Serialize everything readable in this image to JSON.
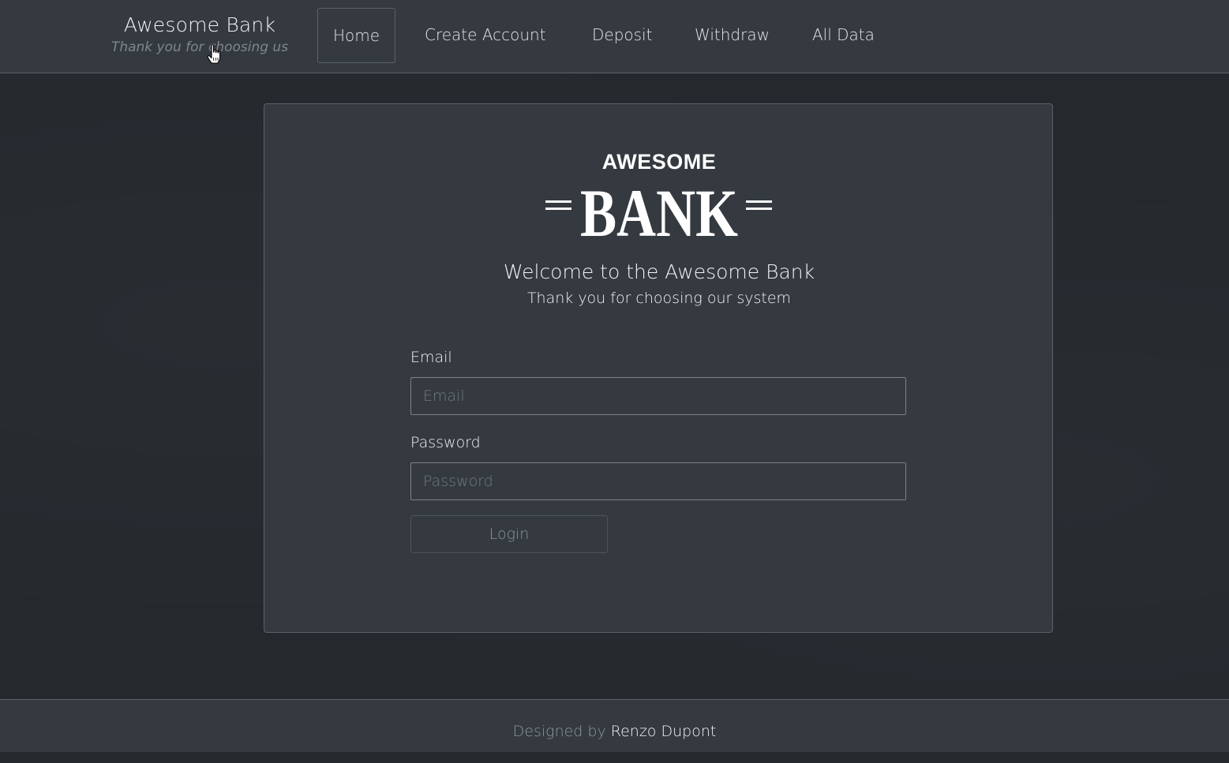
{
  "brand": {
    "title": "Awesome Bank",
    "subtitle": "Thank you for choosing us"
  },
  "nav": {
    "items": [
      {
        "label": "Home",
        "active": true
      },
      {
        "label": "Create Account",
        "active": false
      },
      {
        "label": "Deposit",
        "active": false
      },
      {
        "label": "Withdraw",
        "active": false
      },
      {
        "label": "All Data",
        "active": false
      }
    ]
  },
  "card": {
    "logo": {
      "top_text": "AWESOME",
      "main_text": "BANK"
    },
    "welcome_title": "Welcome to the Awesome Bank",
    "welcome_subtitle": "Thank you for choosing our system",
    "email": {
      "label": "Email",
      "placeholder": "Email",
      "value": ""
    },
    "password": {
      "label": "Password",
      "placeholder": "Password",
      "value": ""
    },
    "login_label": "Login"
  },
  "footer": {
    "prefix": "Designed by",
    "author": "Renzo Dupont"
  },
  "colors": {
    "navbar_bg": "#343a40",
    "page_bg": "#25292e",
    "card_bg": "#343a40",
    "text": "#f1f3f5",
    "muted": "#8e959b"
  },
  "icons": {
    "cursor": "hand-pointer-icon"
  }
}
